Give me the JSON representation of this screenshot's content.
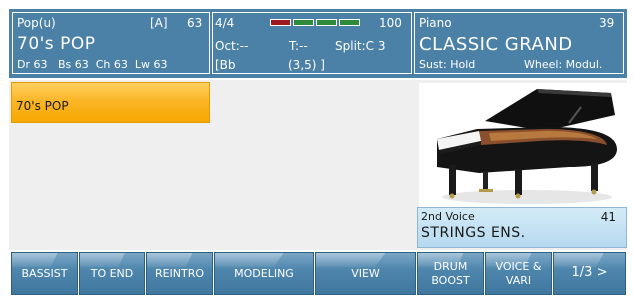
{
  "header": {
    "style_bank": "Pop(u)",
    "style_var": "[A]",
    "style_num": "63",
    "style_name": "70's POP",
    "levels": "Dr 63   Bs 63  Ch 63  Lw 63",
    "time_sig": "4/4",
    "tempo": "100",
    "tempo_bar_colors": [
      "#9e1a20",
      "#2e8b3a",
      "#2e8b3a",
      "#2e8b3a"
    ],
    "oct": "Oct:--",
    "transpose": "T:--",
    "split": "Split:C 3",
    "chord": "[Bb",
    "chord_pos": "(3,5) ]",
    "voice_bank": "Piano",
    "voice_num": "39",
    "voice_name": "CLASSIC GRAND",
    "sust": "Sust: Hold",
    "wheel": "Wheel: Modul."
  },
  "main": {
    "style_button": "70's POP",
    "second_voice_label": "2nd Voice",
    "second_voice_num": "41",
    "second_voice_name": "STRINGS ENS."
  },
  "buttons": [
    {
      "label": "BASSIST"
    },
    {
      "label": "TO END"
    },
    {
      "label": "REINTRO"
    },
    {
      "label": "MODELING"
    },
    {
      "label": "VIEW"
    },
    {
      "label": "DRUM\nBOOST"
    },
    {
      "label": "VOICE &\nVARI"
    },
    {
      "label": "1/3 >"
    }
  ]
}
